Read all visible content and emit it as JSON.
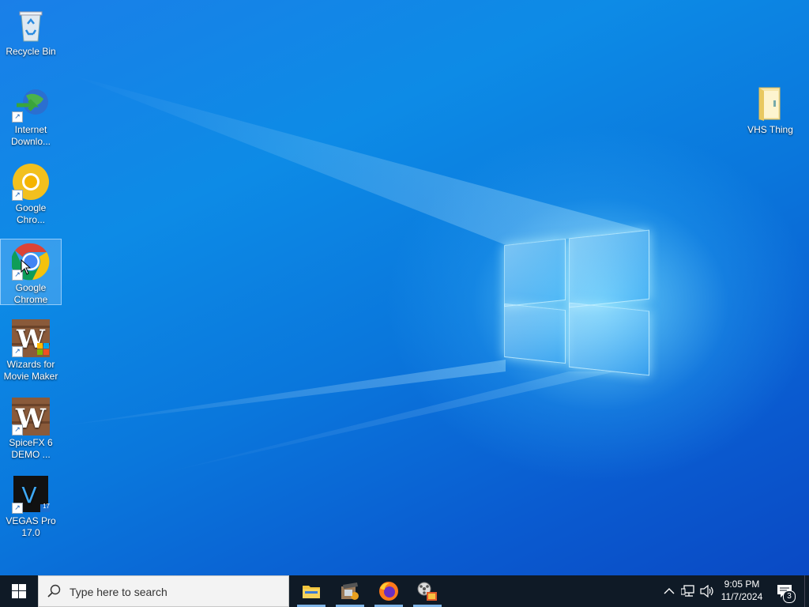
{
  "desktop": {
    "icons": [
      {
        "label": "Recycle Bin",
        "icon": "recycle-bin-icon"
      },
      {
        "label": "Internet Downlo...",
        "icon": "internet-download-manager-icon"
      },
      {
        "label": "Google Chro...",
        "icon": "google-chrome-canary-icon"
      },
      {
        "label": "Google Chrome",
        "icon": "google-chrome-icon",
        "selected": true
      },
      {
        "label": "Wizards for Movie Maker",
        "icon": "wizards-movie-maker-icon"
      },
      {
        "label": "SpiceFX 6 DEMO ...",
        "icon": "spicefx-icon"
      },
      {
        "label": "VEGAS Pro 17.0",
        "icon": "vegas-pro-icon"
      },
      {
        "label": "VHS Thing",
        "icon": "folder-icon"
      }
    ],
    "vegas_badge": "17"
  },
  "taskbar": {
    "search_placeholder": "Type here to search",
    "apps": [
      {
        "name": "File Explorer",
        "icon": "file-explorer-icon",
        "active": true
      },
      {
        "name": "Movie Maker",
        "icon": "movie-maker-icon",
        "active": true
      },
      {
        "name": "Firefox",
        "icon": "firefox-icon",
        "active": true
      },
      {
        "name": "Video Tool",
        "icon": "film-reel-icon",
        "active": true
      }
    ],
    "clock_time": "9:05 PM",
    "clock_date": "11/7/2024",
    "notification_count": "3"
  },
  "colors": {
    "taskbar": "#0f1a26",
    "accent": "#7fb4e6",
    "desktop": "#0a64d8"
  }
}
